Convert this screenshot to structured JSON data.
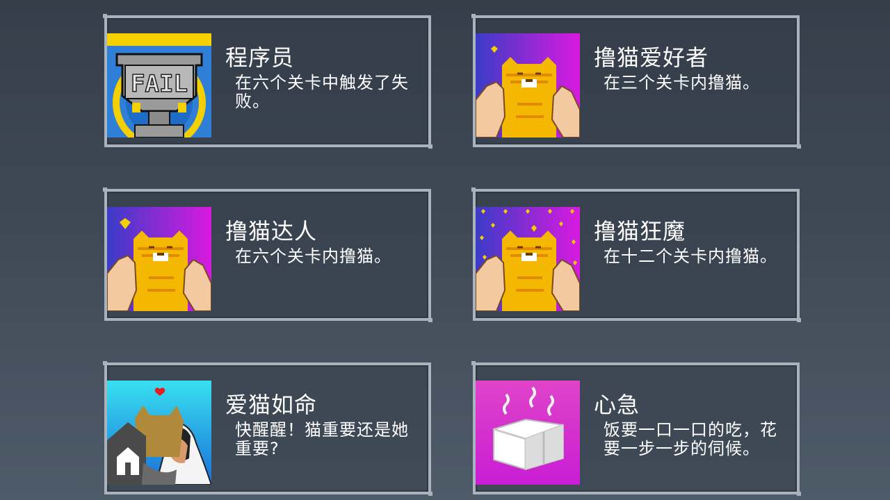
{
  "achievements": [
    {
      "title": "程序员",
      "desc": "在六个关卡中触发了失败。",
      "icon": "fail-trophy-icon"
    },
    {
      "title": "撸猫爱好者",
      "desc": "在三个关卡内撸猫。",
      "icon": "pet-cat-icon"
    },
    {
      "title": "撸猫达人",
      "desc": "在六个关卡内撸猫。",
      "icon": "pet-cat-icon"
    },
    {
      "title": "撸猫狂魔",
      "desc": "在十二个关卡内撸猫。",
      "icon": "pet-cat-hearts-icon"
    },
    {
      "title": "爱猫如命",
      "desc": "快醒醒！猫重要还是她重要?",
      "icon": "cat-and-girl-icon"
    },
    {
      "title": "心急",
      "desc": "饭要一口一口的吃，花要一步一步的伺候。",
      "icon": "steaming-tofu-icon"
    }
  ],
  "trophy_text": "FAIL",
  "colors": {
    "card_border": "#a9b3bd",
    "cat_orange": "#f5b800",
    "bg_magenta": "#d81adf",
    "bg_blue": "#3a3cc8"
  }
}
